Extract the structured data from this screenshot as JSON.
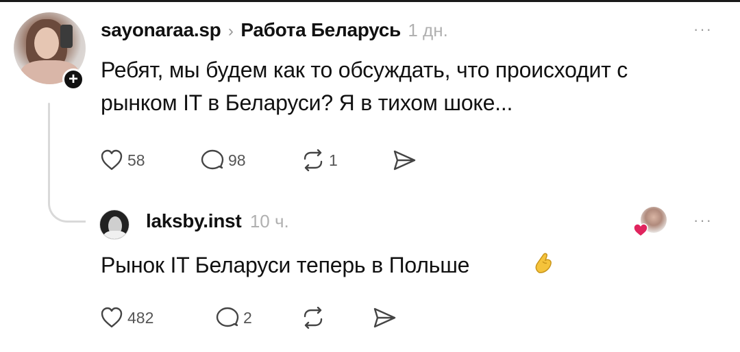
{
  "post": {
    "username": "sayonaraa.sp",
    "chevron": "›",
    "community": "Работа Беларусь",
    "time": "1 дн.",
    "more": "···",
    "text_line1": "Ребят, мы будем как то обсуждать, что происходит с",
    "text_line2": "рынком IT в Беларуси? Я в тихом шоке...",
    "likes": "58",
    "comments": "98",
    "reposts": "1",
    "follow_badge": "+"
  },
  "reply": {
    "username": "laksby.inst",
    "time": "10 ч.",
    "more": "···",
    "text": "Рынок IT Беларуси теперь в Польше",
    "likes": "482",
    "comments": "2"
  },
  "icons": [
    "heart-icon",
    "comment-icon",
    "repost-icon",
    "share-icon",
    "more-icon",
    "pinching-hand-emoji"
  ],
  "colors": {
    "text": "#111111",
    "muted": "#b0b0b0",
    "icon": "#444444",
    "liked_heart": "#e0245e"
  }
}
